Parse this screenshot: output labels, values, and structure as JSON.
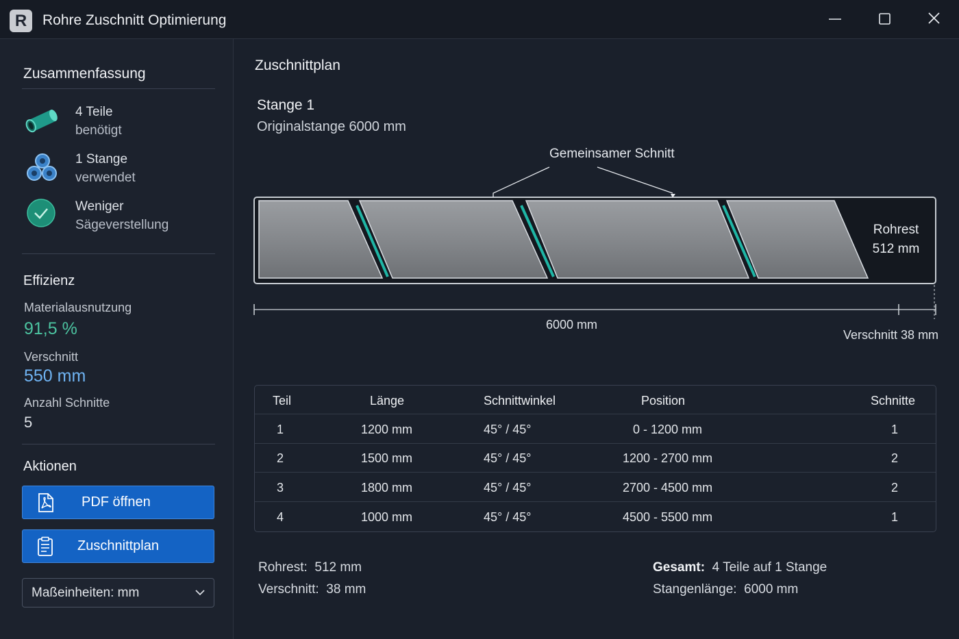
{
  "window": {
    "app_icon_letter": "R",
    "title": "Rohre Zuschnitt Optimierung"
  },
  "sidebar": {
    "summary": {
      "title": "Zusammenfassung",
      "items": [
        {
          "icon": "pipe-icon",
          "line1": "4 Teile",
          "line2": "benötigt"
        },
        {
          "icon": "pipe-stack-icon",
          "line1": "1 Stange",
          "line2": "verwendet"
        },
        {
          "icon": "check-circle-icon",
          "line1": "Weniger",
          "line2": "Sägeverstellung"
        }
      ]
    },
    "efficiency": {
      "title": "Effizienz",
      "utilization_label": "Materialausnutzung",
      "utilization_value": "91,5 %",
      "waste_label": "Verschnitt",
      "waste_value": "550 mm",
      "cuts_label": "Anzahl Schnitte",
      "cuts_value": "5"
    },
    "actions": {
      "title": "Aktionen",
      "pdf_button": "PDF öffnen",
      "plan_button": "Zuschnittplan",
      "units_select": "Maßeinheiten: mm"
    }
  },
  "main": {
    "title": "Zuschnittplan",
    "bar_title": "Stange 1",
    "bar_subtitle": "Originalstange  6000 mm",
    "callout": "Gemeinsamer Schnitt",
    "rest_line1": "Rohrest",
    "rest_line2": "512 mm",
    "dim_total": "6000 mm",
    "dim_waste": "Verschnitt 38 mm",
    "bar": {
      "total_mm": 6000,
      "pieces_mm": [
        1200,
        1500,
        1800,
        1000
      ],
      "rest_mm": 512,
      "waste_mm": 38,
      "colors": {
        "piece": "#8a8d90",
        "cut": "#1fb5a5",
        "rest": "#14181f"
      }
    },
    "table": {
      "headers": [
        "Teil",
        "Länge",
        "Schnittwinkel",
        "Position",
        "Schnitte"
      ],
      "rows": [
        [
          "1",
          "1200 mm",
          "45° / 45°",
          "0 - 1200 mm",
          "1"
        ],
        [
          "2",
          "1500 mm",
          "45° / 45°",
          "1200 - 2700 mm",
          "2"
        ],
        [
          "3",
          "1800 mm",
          "45° / 45°",
          "2700 - 4500 mm",
          "2"
        ],
        [
          "4",
          "1000 mm",
          "45° / 45°",
          "4500 - 5500 mm",
          "1"
        ]
      ]
    },
    "footer": {
      "rest_label": "Rohrest:",
      "rest_value": "512 mm",
      "waste_label": "Verschnitt:",
      "waste_value": "38 mm",
      "total_label": "Gesamt:",
      "total_value": "4 Teile auf 1 Stange",
      "length_label": "Stangenlänge:",
      "length_value": "6000 mm"
    }
  },
  "colors": {
    "accent_green": "#4cc3a0",
    "accent_blue": "#6fb3f2",
    "button_blue": "#1463c4"
  }
}
